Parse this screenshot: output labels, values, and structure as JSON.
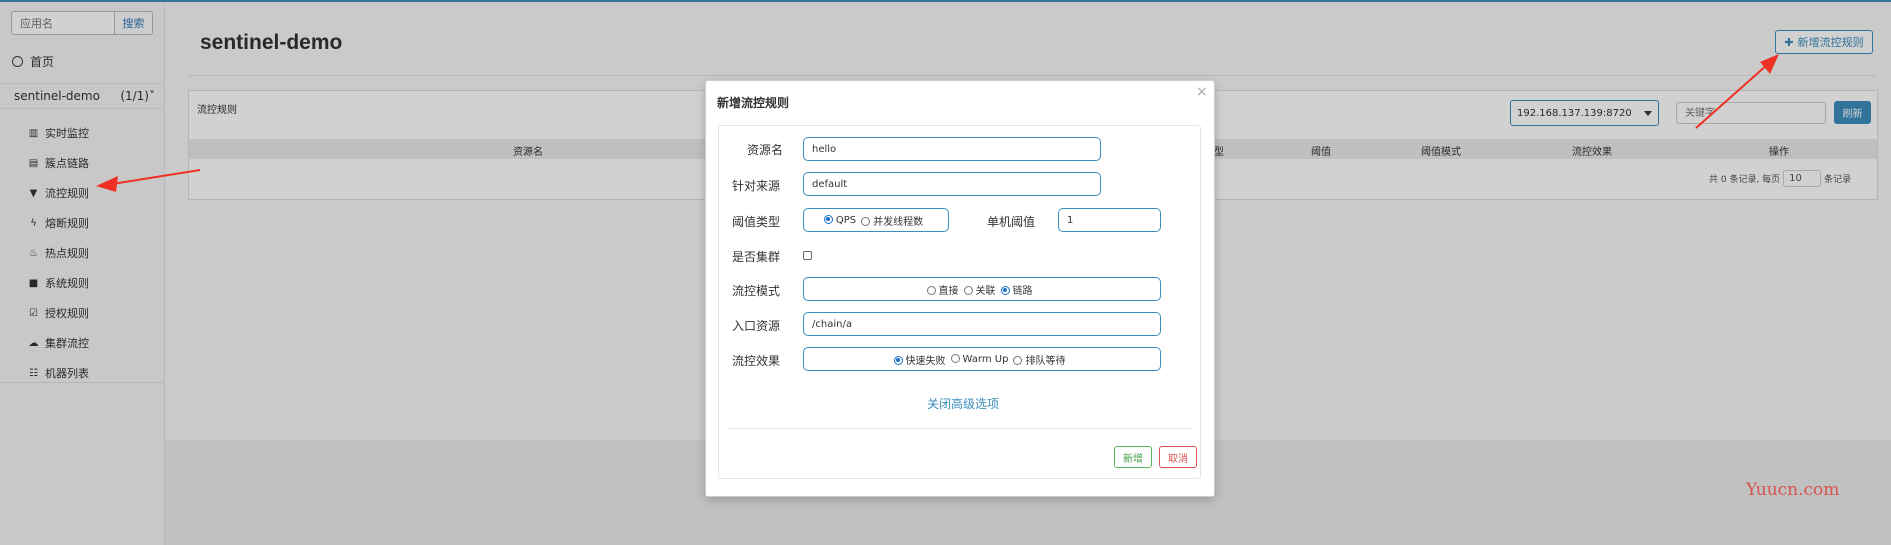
{
  "sidebar": {
    "search_placeholder": "应用名",
    "search_button": "搜索",
    "home": "首页",
    "app_name": "sentinel-demo",
    "app_count": "(1/1)",
    "items": [
      {
        "label": "实时监控",
        "icon": "bar-chart-icon"
      },
      {
        "label": "簇点链路",
        "icon": "list-icon"
      },
      {
        "label": "流控规则",
        "icon": "filter-icon"
      },
      {
        "label": "熔断规则",
        "icon": "flash-icon"
      },
      {
        "label": "热点规则",
        "icon": "fire-icon"
      },
      {
        "label": "系统规则",
        "icon": "lock-icon"
      },
      {
        "label": "授权规则",
        "icon": "check-icon"
      },
      {
        "label": "集群流控",
        "icon": "cloud-icon"
      },
      {
        "label": "机器列表",
        "icon": "th-list-icon"
      }
    ]
  },
  "header": {
    "title": "sentinel-demo",
    "add_rule_label": "新增流控规则"
  },
  "panel": {
    "title": "流控规则",
    "machine_select": "192.168.137.139:8720",
    "keyword_placeholder": "关键字",
    "refresh_label": "刷新",
    "columns": [
      "资源名",
      "类型",
      "阈值",
      "阈值模式",
      "流控效果",
      "操作"
    ],
    "pager": {
      "prefix": "共 0 条记录, 每页",
      "size": "10",
      "suffix": "条记录"
    }
  },
  "modal": {
    "title": "新增流控规则",
    "close": "×",
    "resource_label": "资源名",
    "resource_value": "hello",
    "source_label": "针对来源",
    "source_value": "default",
    "threshold_type_label": "阈值类型",
    "threshold_type_options": [
      "QPS",
      "并发线程数"
    ],
    "single_threshold_label": "单机阈值",
    "single_threshold_value": "1",
    "cluster_label": "是否集群",
    "flow_mode_label": "流控模式",
    "flow_mode_options": [
      "直接",
      "关联",
      "链路"
    ],
    "entry_resource_label": "入口资源",
    "entry_resource_value": "/chain/a",
    "effect_label": "流控效果",
    "effect_options": [
      "快速失败",
      "Warm Up",
      "排队等待"
    ],
    "advanced_link": "关闭高级选项",
    "add_button": "新增",
    "cancel_button": "取消"
  },
  "watermark": "Yuucn.com",
  "colors": {
    "accent": "#3c8dbc",
    "annotation_arrow": "#ee3124",
    "watermark": "#d9534f"
  }
}
